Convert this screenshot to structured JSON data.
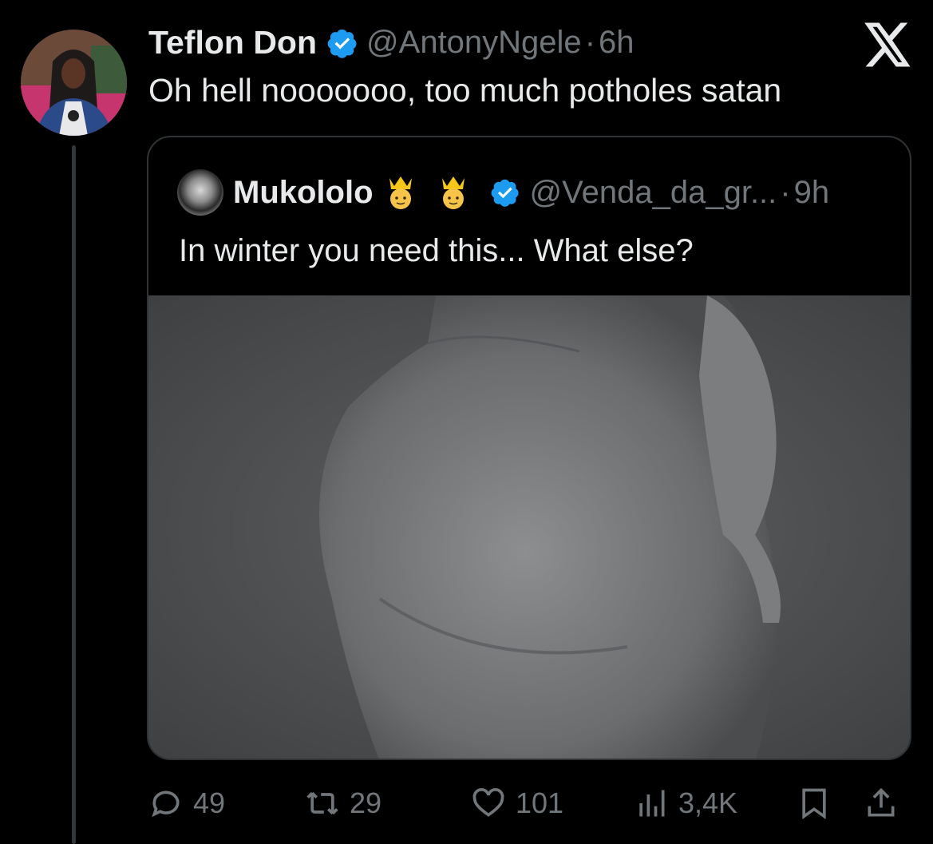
{
  "tweet": {
    "author_name": "Teflon Don",
    "author_handle": "@AntonyNgele",
    "separator": "·",
    "time": "6h",
    "text": "Oh hell nooooooo, too much potholes satan",
    "platform_logo": "x-logo-icon"
  },
  "quote": {
    "author_name": "Mukololo",
    "name_emojis": [
      "prince-emoji",
      "prince-emoji"
    ],
    "author_handle": "@Venda_da_gr...",
    "separator": "·",
    "time": "9h",
    "text": "In winter you need this... What else?",
    "media": "photo"
  },
  "actions": {
    "replies": "49",
    "retweets": "29",
    "likes": "101",
    "views": "3,4K",
    "bookmark_icon": "bookmark-icon",
    "share_icon": "share-icon"
  },
  "colors": {
    "background": "#000000",
    "primary_text": "#e7e9ea",
    "secondary_text": "#71767b",
    "verified_blue": "#1d9bf0",
    "border": "#2f3336"
  }
}
